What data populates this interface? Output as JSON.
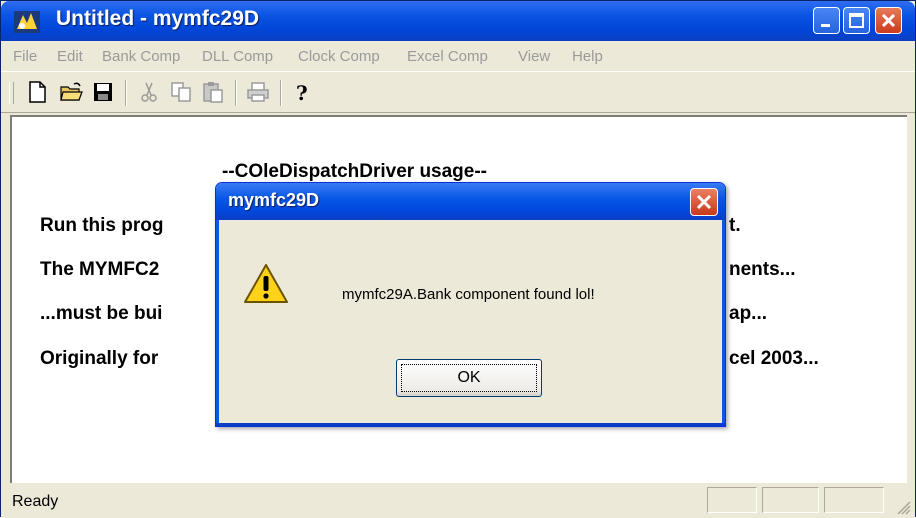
{
  "window": {
    "title": "Untitled - mymfc29D"
  },
  "menu": [
    "File",
    "Edit",
    "Bank Comp",
    "DLL Comp",
    "Clock Comp",
    "Excel Comp",
    "View",
    "Help"
  ],
  "toolbar": {
    "icons": [
      "new-file-icon",
      "open-folder-icon",
      "save-icon",
      "cut-icon",
      "copy-icon",
      "paste-icon",
      "print-icon",
      "help-icon"
    ]
  },
  "client": {
    "heading": "--COleDispatchDriver usage--",
    "lines": [
      "Run this prog",
      "t.",
      "The MYMFC2",
      "nents...",
      "...must be bui",
      "ap...",
      "Originally for",
      "cel 2003..."
    ]
  },
  "status": {
    "text": "Ready"
  },
  "dialog": {
    "title": "mymfc29D",
    "message": "mymfc29A.Bank component found lol!",
    "ok_label": "OK"
  },
  "colors": {
    "title_blue": "#0146d8",
    "face": "#ece9d8",
    "close_red": "#cc3a1e"
  }
}
